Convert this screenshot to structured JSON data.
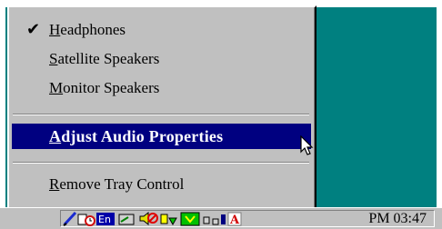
{
  "context_menu": {
    "items": [
      {
        "label": "Headphones",
        "checked": true
      },
      {
        "label": "Satellite Speakers",
        "checked": false
      },
      {
        "label": "Monitor Speakers",
        "checked": false
      },
      {
        "label": "Adjust Audio Properties",
        "selected": true
      },
      {
        "label": "Remove Tray Control"
      }
    ],
    "check_mark": "✔"
  },
  "taskbar": {
    "clock": "PM 03:47",
    "language_indicator": "En",
    "tray_icons": [
      "pen-icon",
      "clock-icon",
      "language-en-icon",
      "audio-icon",
      "volume-mute-icon",
      "app-icon",
      "monitor-icon",
      "network-icon",
      "acrobat-icon"
    ]
  },
  "colors": {
    "desktop": "#008080",
    "menu_bg": "#c0c0c0",
    "selection": "#000080"
  }
}
